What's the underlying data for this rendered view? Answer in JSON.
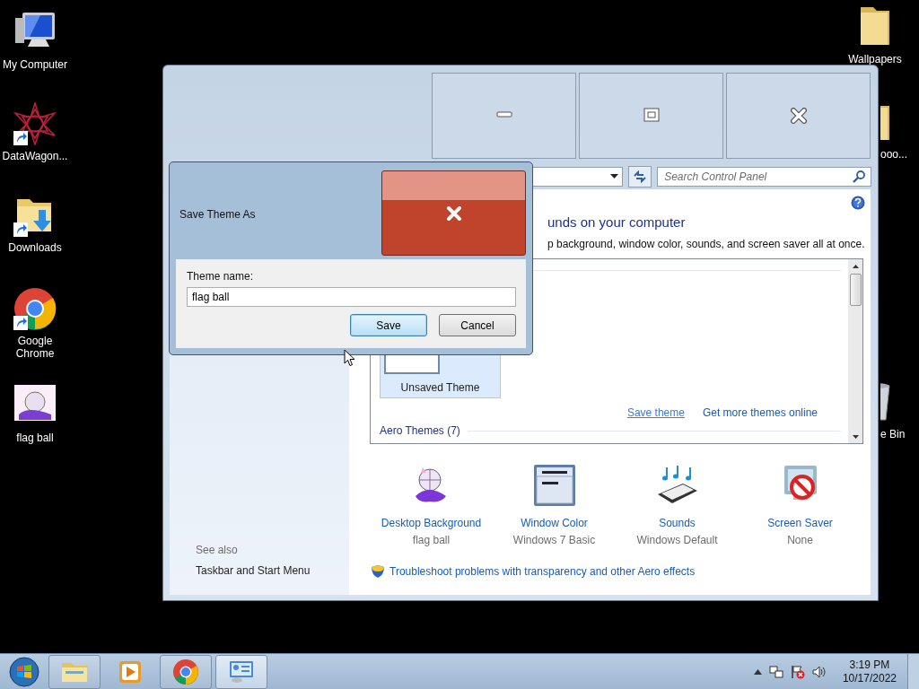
{
  "desktop": {
    "left_icons": [
      {
        "label": "My Computer",
        "kind": "computer",
        "shortcut": false
      },
      {
        "label": "DataWagon...",
        "kind": "star",
        "shortcut": true
      },
      {
        "label": "Downloads",
        "kind": "download-folder",
        "shortcut": true
      },
      {
        "label": "Google\nChrome",
        "kind": "chrome",
        "shortcut": true
      },
      {
        "label": "flag ball",
        "kind": "image",
        "shortcut": false
      }
    ],
    "right_icons": [
      {
        "label": "Wallpapers",
        "kind": "folder",
        "shortcut": false,
        "covered": false
      },
      {
        "label": "ooo...",
        "kind": "folder",
        "shortcut": false,
        "covered": true
      },
      {
        "label": "e Bin",
        "kind": "bin",
        "shortcut": false,
        "covered": true
      }
    ]
  },
  "window": {
    "search": {
      "placeholder": "Search Control Panel"
    },
    "heading": "unds on your computer",
    "description": "p background, window color, sounds, and screen saver all at once.",
    "sidebar": {
      "see_also": "See also",
      "links": [
        "Taskbar and Start Menu"
      ]
    },
    "theme_list": {
      "tiles": [
        {
          "label": "Unsaved Theme",
          "selected": true
        }
      ],
      "save_link": "Save theme",
      "more_link": "Get more themes online",
      "section": "Aero Themes (7)"
    },
    "settings": [
      {
        "kind": "background",
        "label": "Desktop Background",
        "value": "flag ball"
      },
      {
        "kind": "color",
        "label": "Window Color",
        "value": "Windows 7 Basic"
      },
      {
        "kind": "sounds",
        "label": "Sounds",
        "value": "Windows Default"
      },
      {
        "kind": "screensaver",
        "label": "Screen Saver",
        "value": "None"
      }
    ],
    "troubleshoot": "Troubleshoot problems with transparency and other Aero effects"
  },
  "dialog": {
    "title": "Save Theme As",
    "field_label": "Theme name:",
    "value": "flag ball",
    "buttons": [
      {
        "label": "Save",
        "default": true
      },
      {
        "label": "Cancel",
        "default": false
      }
    ]
  },
  "taskbar": {
    "apps": [
      {
        "kind": "explorer",
        "running": true,
        "active": false
      },
      {
        "kind": "media",
        "running": false,
        "active": false
      },
      {
        "kind": "chrome",
        "running": true,
        "active": false
      },
      {
        "kind": "control-panel",
        "running": true,
        "active": true
      }
    ],
    "time": "3:19 PM",
    "date": "10/17/2022"
  }
}
